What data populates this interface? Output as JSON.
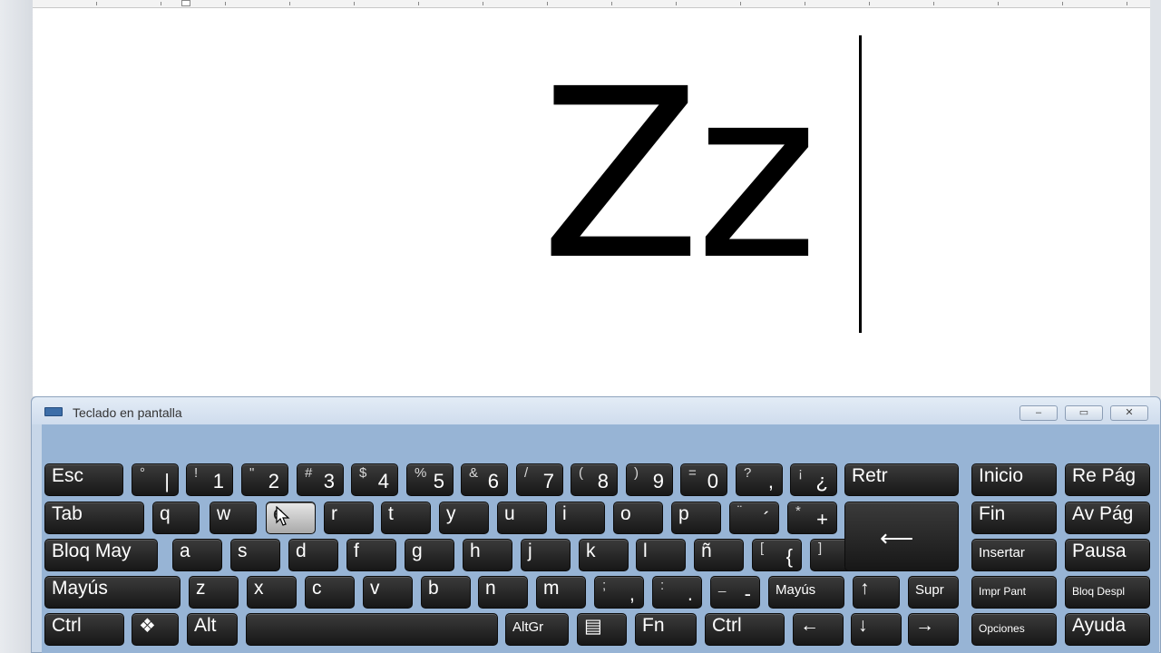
{
  "document": {
    "text": "Zz"
  },
  "osk": {
    "title": "Teclado en pantalla",
    "window_buttons": {
      "minimize": "▭",
      "restore": "▭",
      "close": "✕"
    }
  },
  "keys": [
    {
      "name": "key-esc",
      "main": "Esc"
    },
    {
      "name": "key-ordinal",
      "upper": "°",
      "lower": "|"
    },
    {
      "name": "key-1",
      "upper": "!",
      "lower": "1"
    },
    {
      "name": "key-2",
      "upper": "\"",
      "lower": "2"
    },
    {
      "name": "key-3",
      "upper": "#",
      "lower": "3"
    },
    {
      "name": "key-4",
      "upper": "$",
      "lower": "4"
    },
    {
      "name": "key-5",
      "upper": "%",
      "lower": "5"
    },
    {
      "name": "key-6",
      "upper": "&",
      "lower": "6"
    },
    {
      "name": "key-7",
      "upper": "/",
      "lower": "7"
    },
    {
      "name": "key-8",
      "upper": "(",
      "lower": "8"
    },
    {
      "name": "key-9",
      "upper": ")",
      "lower": "9"
    },
    {
      "name": "key-0",
      "upper": "=",
      "lower": "0"
    },
    {
      "name": "key-apostrophe",
      "upper": "?",
      "lower": ","
    },
    {
      "name": "key-inv-question",
      "upper": "¡",
      "lower": "¿"
    },
    {
      "name": "key-backspace",
      "main": "Retr"
    },
    {
      "name": "key-home",
      "main": "Inicio"
    },
    {
      "name": "key-pageup",
      "main": "Re Pág"
    },
    {
      "name": "key-tab",
      "main": "Tab"
    },
    {
      "name": "key-q",
      "main": "q"
    },
    {
      "name": "key-w",
      "main": "w"
    },
    {
      "name": "key-e",
      "main": "e"
    },
    {
      "name": "key-r",
      "main": "r"
    },
    {
      "name": "key-t",
      "main": "t"
    },
    {
      "name": "key-y",
      "main": "y"
    },
    {
      "name": "key-u",
      "main": "u"
    },
    {
      "name": "key-i",
      "main": "i"
    },
    {
      "name": "key-o",
      "main": "o"
    },
    {
      "name": "key-p",
      "main": "p"
    },
    {
      "name": "key-accent",
      "upper": "¨",
      "lower": "´"
    },
    {
      "name": "key-plus",
      "upper": "*",
      "lower": "+"
    },
    {
      "name": "key-end",
      "main": "Fin"
    },
    {
      "name": "key-pagedown",
      "main": "Av Pág"
    },
    {
      "name": "key-capslock",
      "main": "Bloq May"
    },
    {
      "name": "key-a",
      "main": "a"
    },
    {
      "name": "key-s",
      "main": "s"
    },
    {
      "name": "key-d",
      "main": "d"
    },
    {
      "name": "key-f",
      "main": "f"
    },
    {
      "name": "key-g",
      "main": "g"
    },
    {
      "name": "key-h",
      "main": "h"
    },
    {
      "name": "key-j",
      "main": "j"
    },
    {
      "name": "key-k",
      "main": "k"
    },
    {
      "name": "key-l",
      "main": "l"
    },
    {
      "name": "key-enye",
      "main": "ñ"
    },
    {
      "name": "key-brace-open",
      "upper": "[",
      "lower": "{"
    },
    {
      "name": "key-brace-close",
      "upper": "]",
      "lower": "}"
    },
    {
      "name": "key-insert",
      "main": "Insertar"
    },
    {
      "name": "key-pause",
      "main": "Pausa"
    },
    {
      "name": "key-shift-left",
      "main": "Mayús"
    },
    {
      "name": "key-z",
      "main": "z"
    },
    {
      "name": "key-x",
      "main": "x"
    },
    {
      "name": "key-c",
      "main": "c"
    },
    {
      "name": "key-v",
      "main": "v"
    },
    {
      "name": "key-b",
      "main": "b"
    },
    {
      "name": "key-n",
      "main": "n"
    },
    {
      "name": "key-m",
      "main": "m"
    },
    {
      "name": "key-comma",
      "upper": ";",
      "lower": ","
    },
    {
      "name": "key-period",
      "upper": ":",
      "lower": "."
    },
    {
      "name": "key-minus",
      "upper": "_",
      "lower": "-"
    },
    {
      "name": "key-shift-right",
      "main": "Mayús"
    },
    {
      "name": "key-arrow-up",
      "main": "↑"
    },
    {
      "name": "key-delete",
      "main": "Supr"
    },
    {
      "name": "key-printscreen",
      "main": "Impr Pant"
    },
    {
      "name": "key-scrolllock",
      "main": "Bloq Despl"
    },
    {
      "name": "key-ctrl-left",
      "main": "Ctrl"
    },
    {
      "name": "key-windows",
      "main": "❖"
    },
    {
      "name": "key-alt",
      "main": "Alt"
    },
    {
      "name": "key-space",
      "main": ""
    },
    {
      "name": "key-altgr",
      "main": "AltGr"
    },
    {
      "name": "key-menu",
      "main": "▤"
    },
    {
      "name": "key-fn",
      "main": "Fn"
    },
    {
      "name": "key-ctrl-right",
      "main": "Ctrl"
    },
    {
      "name": "key-arrow-left",
      "main": "←"
    },
    {
      "name": "key-arrow-down",
      "main": "↓"
    },
    {
      "name": "key-arrow-right",
      "main": "→"
    },
    {
      "name": "key-options",
      "main": "Opciones"
    },
    {
      "name": "key-help",
      "main": "Ayuda"
    }
  ]
}
